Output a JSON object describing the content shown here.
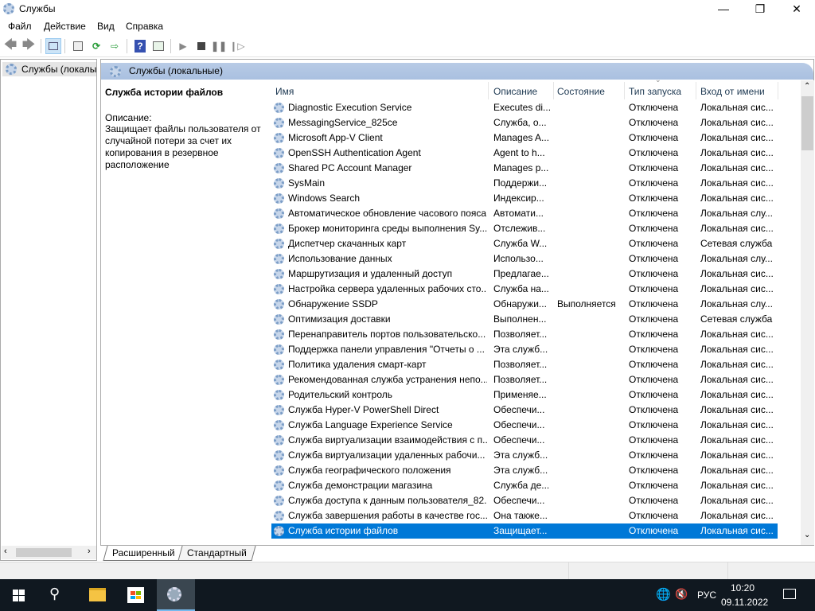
{
  "window": {
    "title": "Службы",
    "icon": "services-gear-icon"
  },
  "menu": [
    "Файл",
    "Действие",
    "Вид",
    "Справка"
  ],
  "toolbar": {
    "icons": [
      "back-arrow-icon",
      "forward-arrow-icon",
      "show-hide-tree-icon",
      "properties-icon",
      "refresh-icon",
      "export-list-icon",
      "help-icon",
      "action-pane-icon",
      "start-service-icon",
      "stop-service-icon",
      "pause-service-icon",
      "resume-service-icon"
    ]
  },
  "tree": {
    "item": "Службы (локалы"
  },
  "panel": {
    "title": "Службы (локальные)",
    "selected_name": "Служба истории файлов",
    "desc_label": "Описание:",
    "desc_text": "Защищает файлы пользователя от случайной потери за счет их копирования в резервное расположение"
  },
  "columns": [
    "Имя",
    "Описание",
    "Состояние",
    "Тип запуска",
    "Вход от имени"
  ],
  "rows": [
    [
      "Diagnostic Execution Service",
      "Executes di...",
      "",
      "Отключена",
      "Локальная сис..."
    ],
    [
      "MessagingService_825ce",
      "Служба, о...",
      "",
      "Отключена",
      "Локальная сис..."
    ],
    [
      "Microsoft App-V Client",
      "Manages A...",
      "",
      "Отключена",
      "Локальная сис..."
    ],
    [
      "OpenSSH Authentication Agent",
      "Agent to h...",
      "",
      "Отключена",
      "Локальная сис..."
    ],
    [
      "Shared PC Account Manager",
      "Manages p...",
      "",
      "Отключена",
      "Локальная сис..."
    ],
    [
      "SysMain",
      "Поддержи...",
      "",
      "Отключена",
      "Локальная сис..."
    ],
    [
      "Windows Search",
      "Индексир...",
      "",
      "Отключена",
      "Локальная сис..."
    ],
    [
      "Автоматическое обновление часового пояса",
      "Автомати...",
      "",
      "Отключена",
      "Локальная слу..."
    ],
    [
      "Брокер мониторинга среды выполнения Sy...",
      "Отслежив...",
      "",
      "Отключена",
      "Локальная сис..."
    ],
    [
      "Диспетчер скачанных карт",
      "Служба W...",
      "",
      "Отключена",
      "Сетевая служба"
    ],
    [
      "Использование данных",
      "Использо...",
      "",
      "Отключена",
      "Локальная слу..."
    ],
    [
      "Маршрутизация и удаленный доступ",
      "Предлагае...",
      "",
      "Отключена",
      "Локальная сис..."
    ],
    [
      "Настройка сервера удаленных рабочих сто...",
      "Служба на...",
      "",
      "Отключена",
      "Локальная сис..."
    ],
    [
      "Обнаружение SSDP",
      "Обнаружи...",
      "Выполняется",
      "Отключена",
      "Локальная слу..."
    ],
    [
      "Оптимизация доставки",
      "Выполнен...",
      "",
      "Отключена",
      "Сетевая служба"
    ],
    [
      "Перенаправитель портов пользовательско...",
      "Позволяет...",
      "",
      "Отключена",
      "Локальная сис..."
    ],
    [
      "Поддержка панели управления \"Отчеты о ...",
      "Эта служб...",
      "",
      "Отключена",
      "Локальная сис..."
    ],
    [
      "Политика удаления смарт-карт",
      "Позволяет...",
      "",
      "Отключена",
      "Локальная сис..."
    ],
    [
      "Рекомендованная служба устранения непо...",
      "Позволяет...",
      "",
      "Отключена",
      "Локальная сис..."
    ],
    [
      "Родительский контроль",
      "Применяе...",
      "",
      "Отключена",
      "Локальная сис..."
    ],
    [
      "Служба Hyper-V PowerShell Direct",
      "Обеспечи...",
      "",
      "Отключена",
      "Локальная сис..."
    ],
    [
      "Служба Language Experience Service",
      "Обеспечи...",
      "",
      "Отключена",
      "Локальная сис..."
    ],
    [
      "Служба виртуализации взаимодействия с п...",
      "Обеспечи...",
      "",
      "Отключена",
      "Локальная сис..."
    ],
    [
      "Служба виртуализации удаленных рабочи...",
      "Эта служб...",
      "",
      "Отключена",
      "Локальная сис..."
    ],
    [
      "Служба географического положения",
      "Эта служб...",
      "",
      "Отключена",
      "Локальная сис..."
    ],
    [
      "Служба демонстрации магазина",
      "Служба де...",
      "",
      "Отключена",
      "Локальная сис..."
    ],
    [
      "Служба доступа к данным пользователя_82...",
      "Обеспечи...",
      "",
      "Отключена",
      "Локальная сис..."
    ],
    [
      "Служба завершения работы в качестве гос...",
      "Она также...",
      "",
      "Отключена",
      "Локальная сис..."
    ],
    [
      "Служба истории файлов",
      "Защищает...",
      "",
      "Отключена",
      "Локальная сис..."
    ]
  ],
  "selected_row": 28,
  "tabs": [
    "Расширенный",
    "Стандартный"
  ],
  "taskbar": {
    "lang": "РУС",
    "time": "10:20",
    "date": "09.11.2022"
  },
  "colors": {
    "selection": "#0078d7",
    "band": "#b8cbe6",
    "taskbar": "#101820"
  }
}
